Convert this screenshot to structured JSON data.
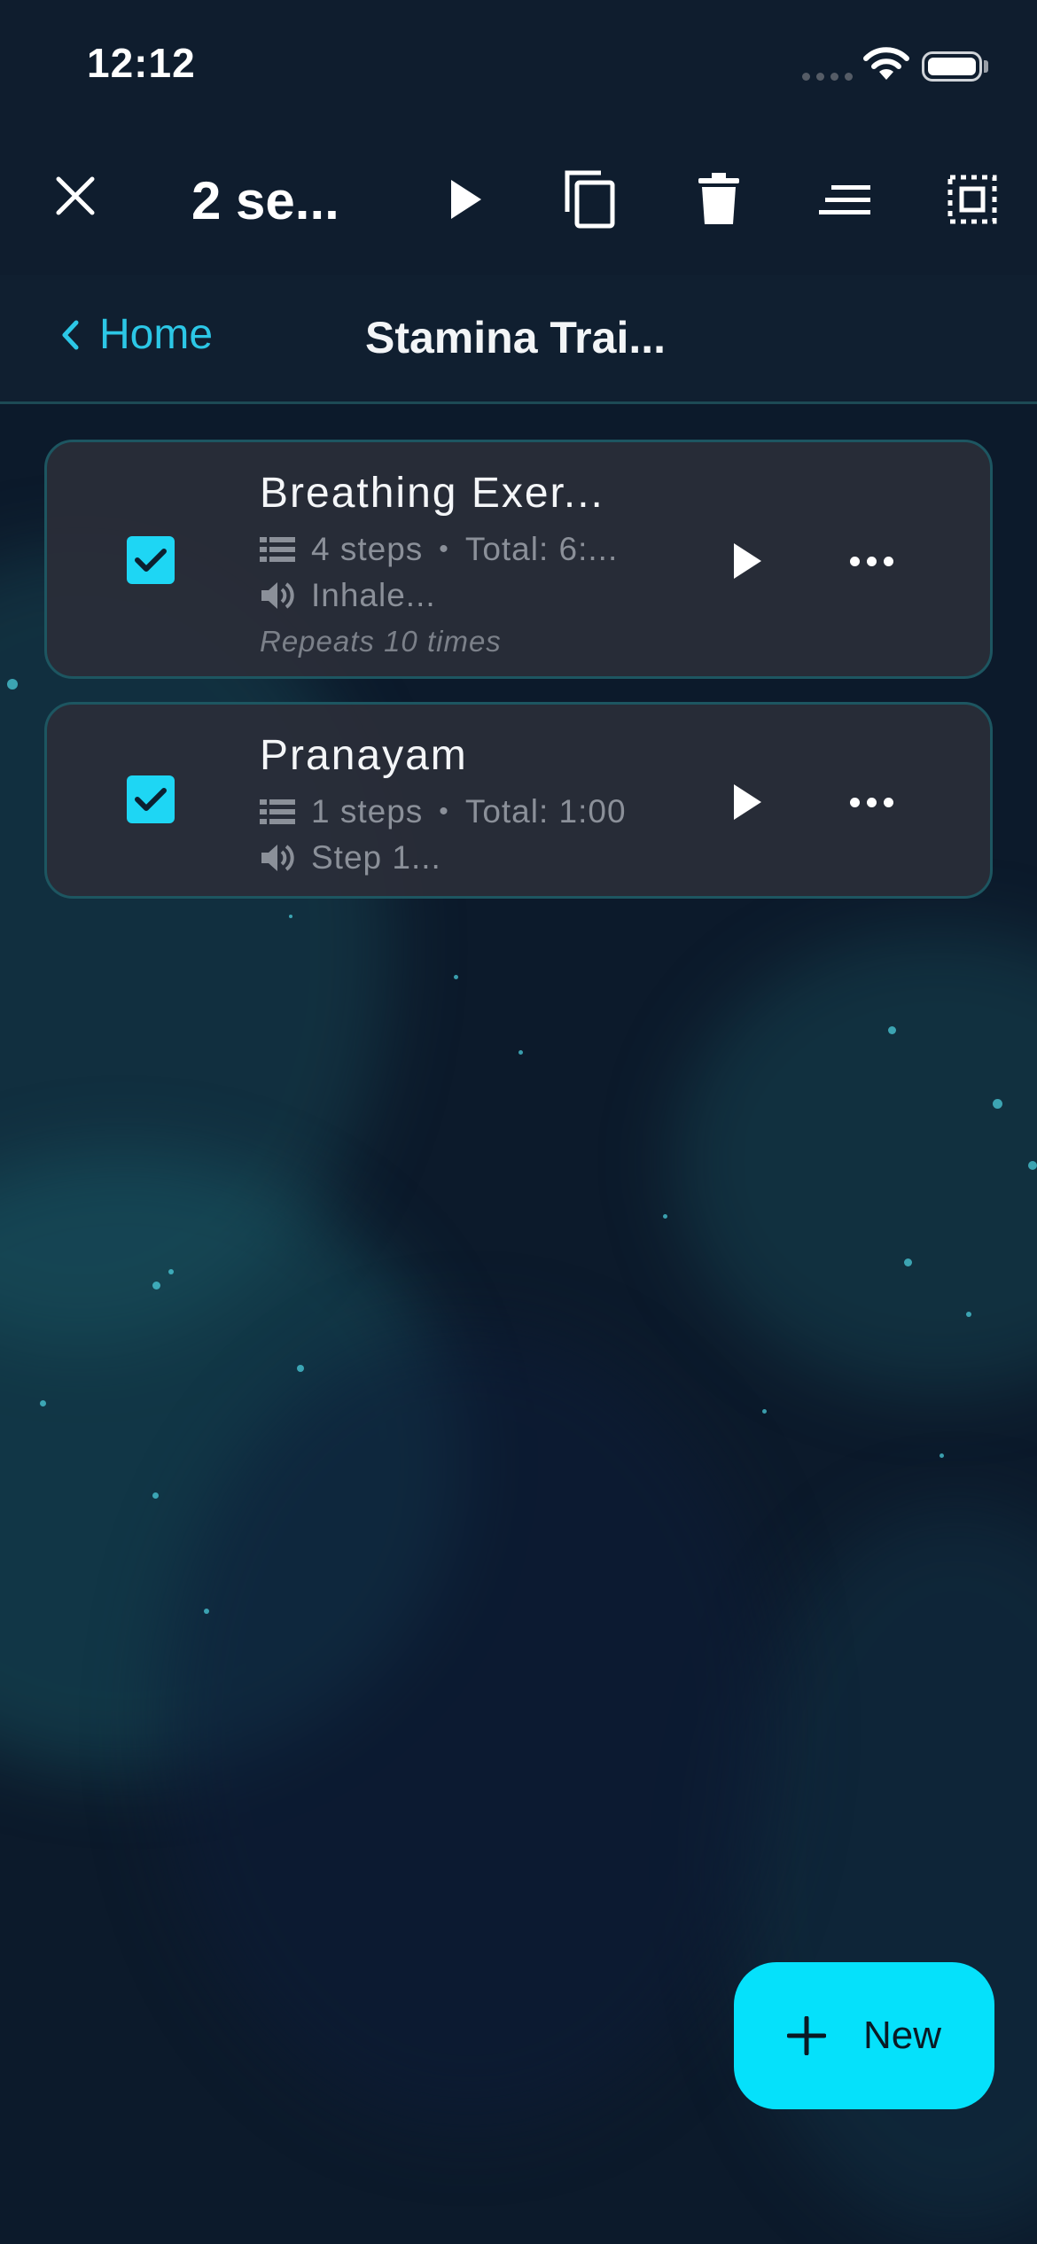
{
  "status_bar": {
    "time": "12:12"
  },
  "toolbar": {
    "selection_title": "2 se...",
    "icons": [
      "close-icon",
      "play-icon",
      "copy-icon",
      "delete-icon",
      "sort-icon",
      "select-all-icon"
    ]
  },
  "breadcrumb": {
    "back_label": "Home",
    "title": "Stamina Trai..."
  },
  "sessions": [
    {
      "title": "Breathing Exer...",
      "steps": "4 steps",
      "total": "Total: 6:...",
      "audio": "Inhale...",
      "repeat": "Repeats 10 times",
      "checked": true
    },
    {
      "title": "Pranayam",
      "steps": "1 steps",
      "total": "Total: 1:00",
      "audio": "Step 1...",
      "checked": true
    }
  ],
  "fab": {
    "label": "New"
  },
  "colors": {
    "accent": "#05e1fb",
    "link": "#2cc7e6",
    "background": "#0c1a2b",
    "card": "#2a2e38"
  }
}
